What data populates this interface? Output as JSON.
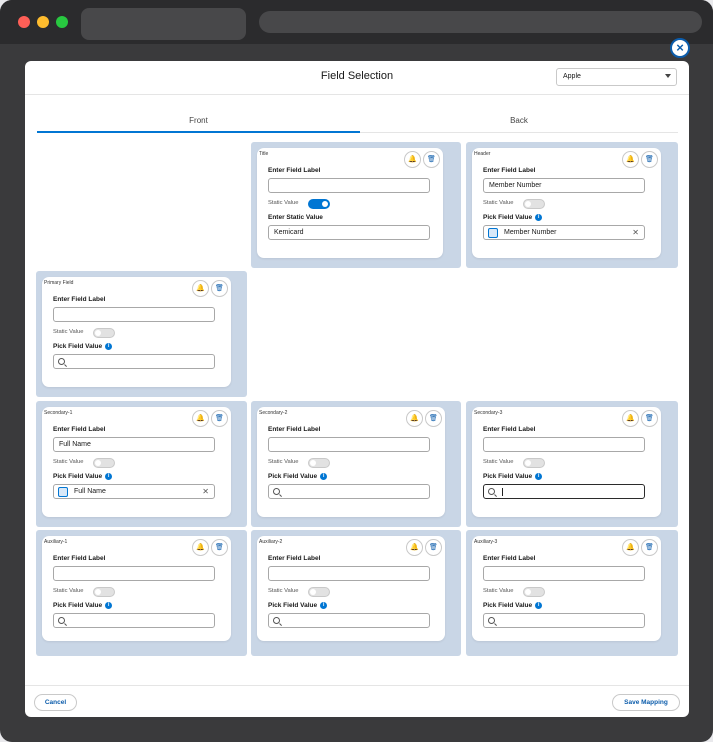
{
  "modal": {
    "title": "Field Selection",
    "select_value": "Apple",
    "tabs": [
      "Front",
      "Back"
    ],
    "cancel_label": "Cancel",
    "save_label": "Save Mapping"
  },
  "labels": {
    "enter_field_label": "Enter Field Label",
    "static_value": "Static Value",
    "enter_static_value": "Enter Static Value",
    "pick_field_value": "Pick Field Value"
  },
  "cards": {
    "title": {
      "name": "Title",
      "field_label": "",
      "static_on": true,
      "static_value": "Kemicard"
    },
    "header": {
      "name": "Header",
      "field_label": "Member Number",
      "static_on": false,
      "picked": "Member Number"
    },
    "primary": {
      "name": "Primary Field",
      "field_label": "",
      "static_on": false,
      "picked": ""
    },
    "secondary1": {
      "name": "Secondary-1",
      "field_label": "Full Name",
      "static_on": false,
      "picked": "Full Name"
    },
    "secondary2": {
      "name": "Secondary-2",
      "field_label": "",
      "static_on": false,
      "picked": ""
    },
    "secondary3": {
      "name": "Secondary-3",
      "field_label": "",
      "static_on": false,
      "picked": ""
    },
    "auxiliary1": {
      "name": "Auxiliary-1",
      "field_label": "",
      "static_on": false,
      "picked": ""
    },
    "auxiliary2": {
      "name": "Auxiliary-2",
      "field_label": "",
      "static_on": false,
      "picked": ""
    },
    "auxiliary3": {
      "name": "Auxiliary-3",
      "field_label": "",
      "static_on": false,
      "picked": ""
    }
  },
  "icons": {
    "bell": "bell-icon",
    "trash": "trash-icon",
    "search": "search-icon",
    "info": "info-icon",
    "close": "close-icon"
  },
  "colors": {
    "accent": "#0176d3",
    "cell_bg": "#c9d6e6"
  }
}
